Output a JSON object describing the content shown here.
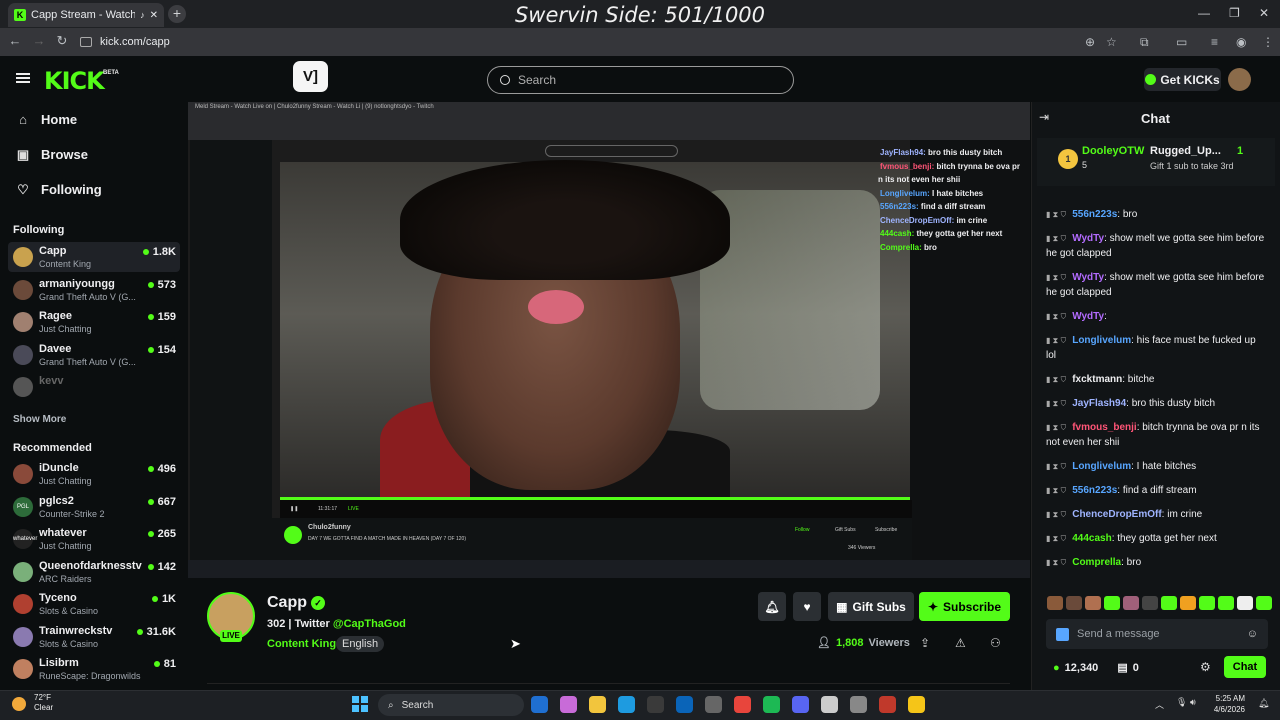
{
  "browser": {
    "tab_title": "Capp Stream - Watch Live o",
    "url": "kick.com/capp",
    "overlay_text": "Swervin Side: 501/1000"
  },
  "header": {
    "search_placeholder": "Search",
    "get_kicks": "Get KICKs",
    "logo": "KICK",
    "beta": "BETA"
  },
  "nav": {
    "home": "Home",
    "browse": "Browse",
    "following": "Following"
  },
  "sidebar": {
    "following_title": "Following",
    "following": [
      {
        "name": "Capp",
        "sub": "Content King",
        "viewers": "1.8K",
        "color": "#c9a24e"
      },
      {
        "name": "armaniyoungg",
        "sub": "Grand Theft Auto V (G...",
        "viewers": "573",
        "color": "#6b4a3a"
      },
      {
        "name": "Ragee",
        "sub": "Just Chatting",
        "viewers": "159",
        "color": "#a08070"
      },
      {
        "name": "Davee",
        "sub": "Grand Theft Auto V (G...",
        "viewers": "154",
        "color": "#4a4a58"
      },
      {
        "name": "kevv",
        "sub": "",
        "viewers": "",
        "color": "#555"
      }
    ],
    "show_more": "Show More",
    "recommended_title": "Recommended",
    "recommended": [
      {
        "name": "iDuncle",
        "sub": "Just Chatting",
        "viewers": "496",
        "color": "#8a4a3a"
      },
      {
        "name": "pglcs2",
        "sub": "Counter-Strike 2",
        "viewers": "667",
        "color": "#2d6b3a",
        "initials": "PGL"
      },
      {
        "name": "whatever",
        "sub": "Just Chatting",
        "viewers": "265",
        "color": "#222",
        "initials": "whatever"
      },
      {
        "name": "Queenofdarknesstv",
        "sub": "ARC Raiders",
        "viewers": "142",
        "color": "#7ab07a"
      },
      {
        "name": "Tyceno",
        "sub": "Slots & Casino",
        "viewers": "1K",
        "color": "#b04030"
      },
      {
        "name": "Trainwreckstv",
        "sub": "Slots & Casino",
        "viewers": "31.6K",
        "color": "#8a7ab0"
      },
      {
        "name": "Lisibrm",
        "sub": "RuneScape: Dragonwilds",
        "viewers": "81",
        "color": "#c08060"
      }
    ]
  },
  "video_overlay": {
    "inner_channel": "Chulo2funny",
    "inner_title": "DAY 7 WE GOTTA FIND A MATCH MADE IN HEAVEN (DAY 7 OF 120)",
    "inner_viewers": "346 Viewers",
    "time": "11:31:17",
    "live": "LIVE",
    "inner_follow": "Follow",
    "inner_gift": "Gift Subs",
    "inner_subscribe": "Subscribe",
    "chat_lines": [
      {
        "user": "JayFlash94:",
        "text": " bro this dusty bitch",
        "color": "#9fb4ff"
      },
      {
        "user": "fvmous_benji:",
        "text": " bitch trynna be ova pr",
        "color": "#ff5577"
      },
      {
        "user": "",
        "text": "n its not even her shii",
        "color": "#fff"
      },
      {
        "user": "Longlivelum:",
        "text": " I hate bitches",
        "color": "#58a6ff"
      },
      {
        "user": "556n223s:",
        "text": " find a diff stream",
        "color": "#58a6ff"
      },
      {
        "user": "ChenceDropEmOff:",
        "text": " im crine",
        "color": "#9fb4ff"
      },
      {
        "user": "444cash:",
        "text": " they gotta get her next",
        "color": "#53fc18"
      },
      {
        "user": "Comprella:",
        "text": " bro",
        "color": "#53fc18"
      }
    ]
  },
  "stream": {
    "name": "Capp",
    "viewers_count": "302",
    "title_prefix": "302 | Twitter ",
    "title_handle": "@CapThaGod",
    "category": "Content King",
    "language": "English",
    "viewers_value": "1,808",
    "viewers_label": "Viewers",
    "live": "LIVE",
    "gift_subs": "Gift Subs",
    "subscribe": "Subscribe"
  },
  "chat": {
    "title": "Chat",
    "pinned": [
      {
        "user": "DooleyOTW",
        "count": "5"
      },
      {
        "user": "Rugged_Up...",
        "count": "1",
        "caption": "Gift 1 sub to take 3rd"
      }
    ],
    "messages": [
      {
        "user": "556n223s",
        "text": ": bro",
        "color": "#58a6ff"
      },
      {
        "user": "WydTy",
        "text": ": show melt we gotta see him before he got clapped",
        "color": "#b36bff"
      },
      {
        "user": "WydTy",
        "text": ": show melt we gotta see him before he got clapped",
        "color": "#b36bff"
      },
      {
        "user": "WydTy",
        "text": ":",
        "color": "#b36bff"
      },
      {
        "user": "Longlivelum",
        "text": ": his face must be fucked up lol",
        "color": "#58a6ff"
      },
      {
        "user": "fxcktmann",
        "text": ": bitche",
        "color": "#efeff1"
      },
      {
        "user": "JayFlash94",
        "text": ": bro this dusty bitch",
        "color": "#9fb4ff"
      },
      {
        "user": "fvmous_benji",
        "text": ": bitch trynna be ova pr n its not even her shii",
        "color": "#ff5577"
      },
      {
        "user": "Longlivelum",
        "text": ": I hate bitches",
        "color": "#58a6ff"
      },
      {
        "user": "556n223s",
        "text": ": find a diff stream",
        "color": "#58a6ff"
      },
      {
        "user": "ChenceDropEmOff",
        "text": ": im crine",
        "color": "#9fb4ff"
      },
      {
        "user": "444cash",
        "text": ": they gotta get her next",
        "color": "#53fc18"
      },
      {
        "user": "Comprella",
        "text": ": bro",
        "color": "#53fc18"
      }
    ],
    "input_placeholder": "Send a message",
    "points": "12,340",
    "points2": "0",
    "send": "Chat"
  },
  "taskbar": {
    "temp": "72°F",
    "weather": "Clear",
    "search": "Search",
    "time": "5:25 AM",
    "date": "4/6/2026"
  },
  "colors": {
    "accent": "#53fc18",
    "bg": "#0b0e0f"
  }
}
